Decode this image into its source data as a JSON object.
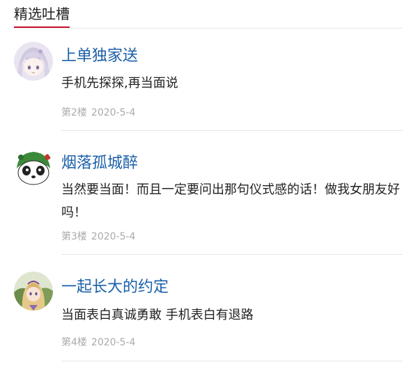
{
  "section": {
    "title": "精选吐槽"
  },
  "comments": [
    {
      "username": "上单独家送",
      "text": "手机先探探,再当面说",
      "floor": "第2楼",
      "date": "2020-5-4",
      "avatar": "anime-girl-avatar"
    },
    {
      "username": "烟落孤城醉",
      "text": "当然要当面！而且一定要问出那句仪式感的话！做我女朋友好吗！",
      "floor": "第3楼",
      "date": "2020-5-4",
      "avatar": "panda-frog-avatar"
    },
    {
      "username": "一起长大的约定",
      "text": "当面表白真诚勇敢 手机表白有退路",
      "floor": "第4楼",
      "date": "2020-5-4",
      "avatar": "anime-blonde-avatar"
    }
  ],
  "colors": {
    "username": "#1a5fa8",
    "accent": "#c8102e",
    "meta": "#aaaaaa",
    "divider": "#e6e6e6"
  }
}
